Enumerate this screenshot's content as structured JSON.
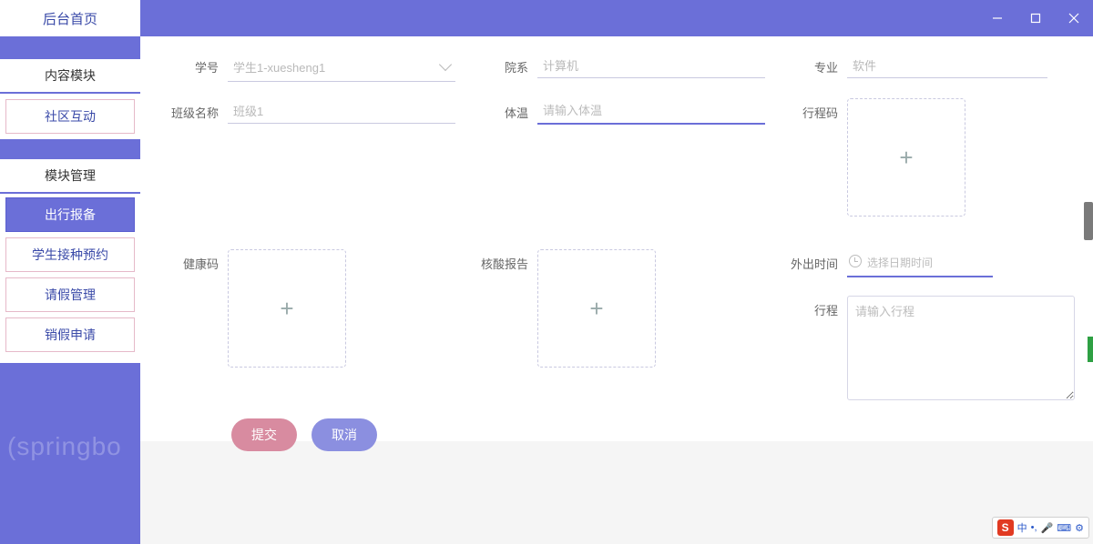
{
  "window": {
    "home_label": "后台首页"
  },
  "sidebar": {
    "groups": [
      {
        "label": "内容模块",
        "items": [
          {
            "label": "社区互动"
          }
        ]
      },
      {
        "label": "模块管理",
        "items": [
          {
            "label": "出行报备",
            "active": true
          },
          {
            "label": "学生接种预约"
          },
          {
            "label": "请假管理"
          },
          {
            "label": "销假申请"
          }
        ]
      }
    ],
    "watermark": "(springbo"
  },
  "form": {
    "student_id": {
      "label": "学号",
      "value": "学生1-xuesheng1"
    },
    "department": {
      "label": "院系",
      "value": "计算机"
    },
    "major": {
      "label": "专业",
      "value": "软件"
    },
    "class_name": {
      "label": "班级名称",
      "value": "班级1"
    },
    "temperature": {
      "label": "体温",
      "placeholder": "请输入体温",
      "value": ""
    },
    "travel_code": {
      "label": "行程码"
    },
    "health_code": {
      "label": "健康码"
    },
    "nat_report": {
      "label": "核酸报告"
    },
    "out_time": {
      "label": "外出时间",
      "placeholder": "选择日期时间"
    },
    "itinerary": {
      "label": "行程",
      "placeholder": "请输入行程",
      "value": ""
    }
  },
  "buttons": {
    "submit": "提交",
    "cancel": "取消"
  },
  "ime": {
    "logo": "S",
    "lang": "中"
  }
}
